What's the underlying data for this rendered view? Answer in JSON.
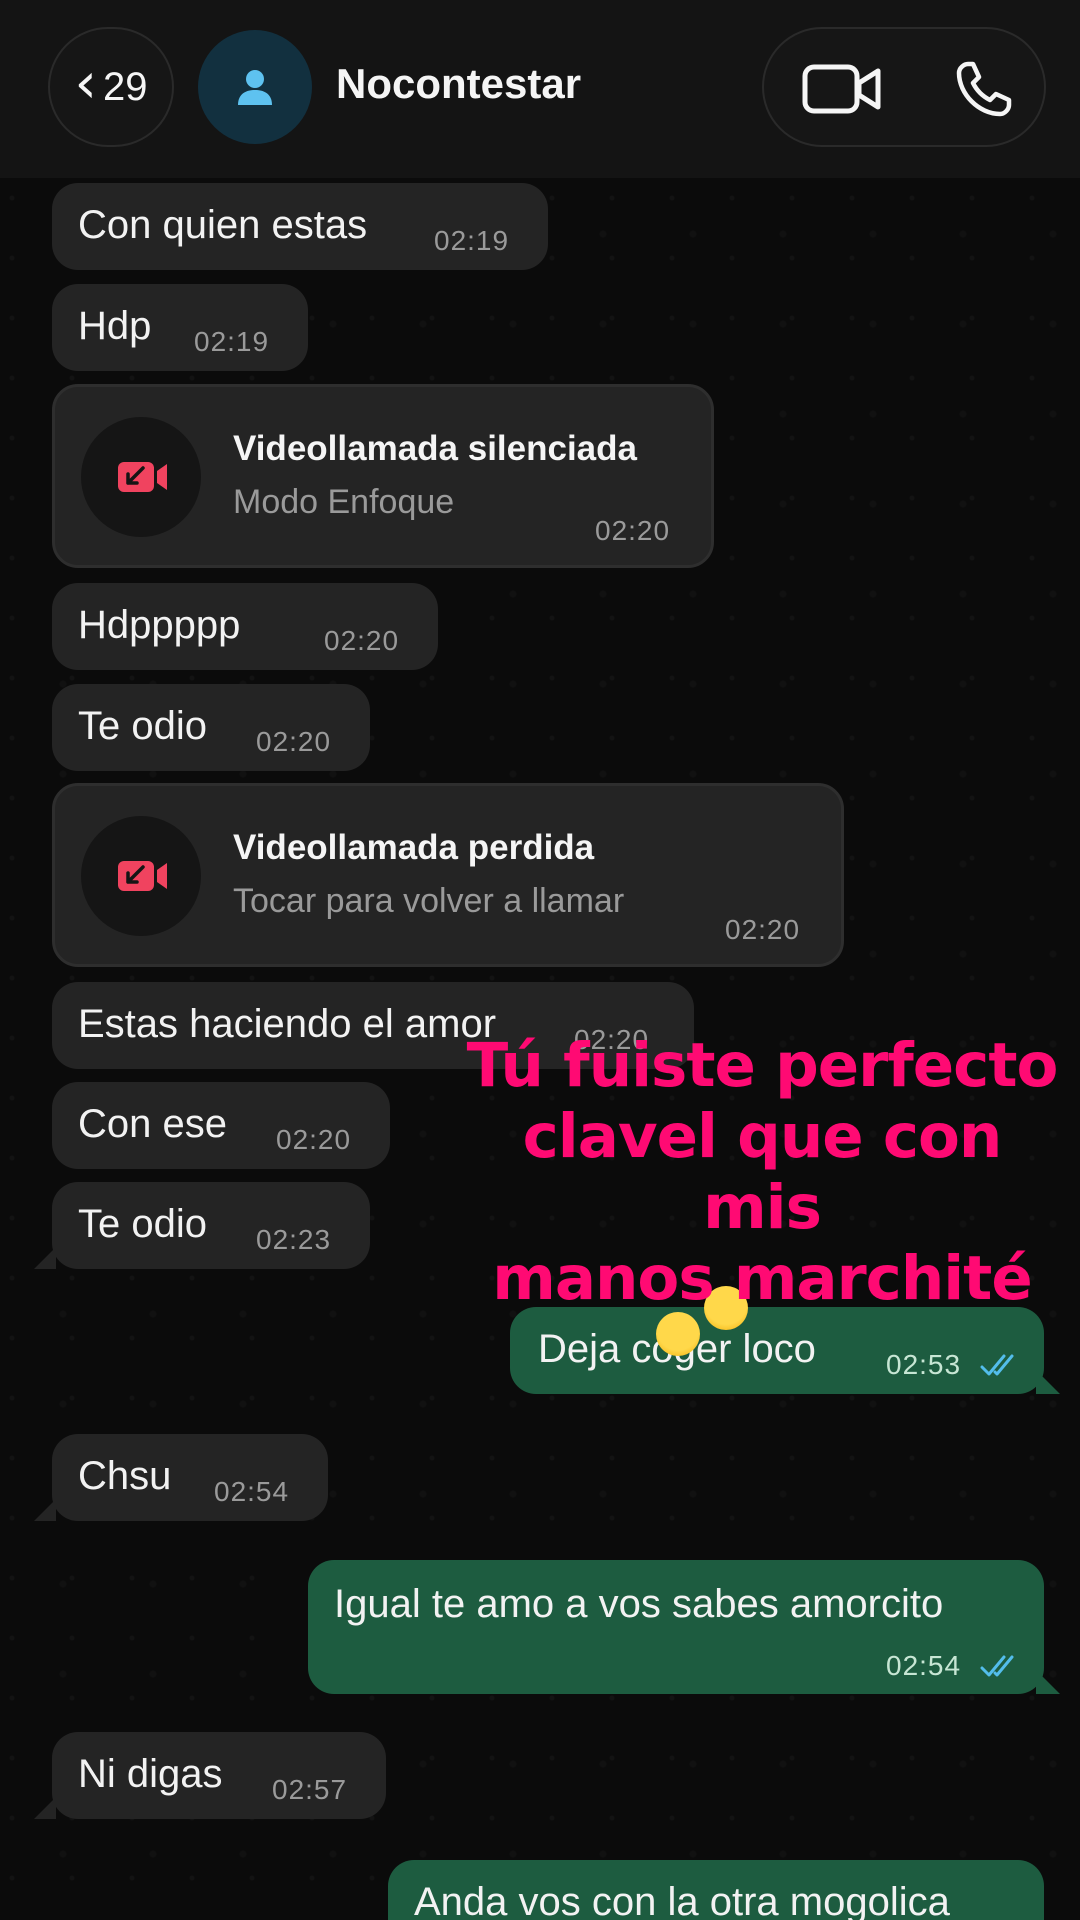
{
  "header": {
    "back_count": "29",
    "contact_name": "Nocontestar"
  },
  "messages": [
    {
      "direction": "in",
      "text": "Con quien estas",
      "time": "02:19"
    },
    {
      "direction": "in",
      "text": "Hdp",
      "time": "02:19"
    },
    {
      "direction": "in",
      "type": "call",
      "title": "Videollamada silenciada",
      "subtitle": "Modo Enfoque",
      "time": "02:20"
    },
    {
      "direction": "in",
      "text": "Hdppppp",
      "time": "02:20"
    },
    {
      "direction": "in",
      "text": "Te odio",
      "time": "02:20"
    },
    {
      "direction": "in",
      "type": "call",
      "title": "Videollamada perdida",
      "subtitle": "Tocar para volver a llamar",
      "time": "02:20"
    },
    {
      "direction": "in",
      "text": "Estas haciendo el amor",
      "time": "02:20"
    },
    {
      "direction": "in",
      "text": "Con ese",
      "time": "02:20"
    },
    {
      "direction": "in",
      "text": "Te odio",
      "time": "02:23"
    },
    {
      "direction": "out",
      "text": "Deja coger loco",
      "time": "02:53",
      "status": "read"
    },
    {
      "direction": "in",
      "text": "Chsu",
      "time": "02:54"
    },
    {
      "direction": "out",
      "text": "Igual te amo a vos sabes amorcito",
      "time": "02:54",
      "status": "read"
    },
    {
      "direction": "in",
      "text": "Ni digas",
      "time": "02:57"
    },
    {
      "direction": "out",
      "text": "Anda vos con la otra mogolica",
      "time": "",
      "status": ""
    }
  ],
  "overlay": {
    "line1": "Tú fuiste perfecto",
    "line2": "clavel que con mis",
    "line3": "manos marchité",
    "color": "#ff0a73"
  },
  "icons": {
    "back": "chevron-left-icon",
    "avatar": "person-icon",
    "video": "video-camera-icon",
    "phone": "phone-icon",
    "missed_video": "missed-video-call-icon",
    "read": "double-check-icon",
    "emoji": "tears-of-joy-emoji"
  },
  "colors": {
    "incoming_bubble": "#242424",
    "outgoing_bubble": "#1d5c40",
    "missed_call_red": "#f0435f",
    "read_ticks": "#53bdeb"
  }
}
